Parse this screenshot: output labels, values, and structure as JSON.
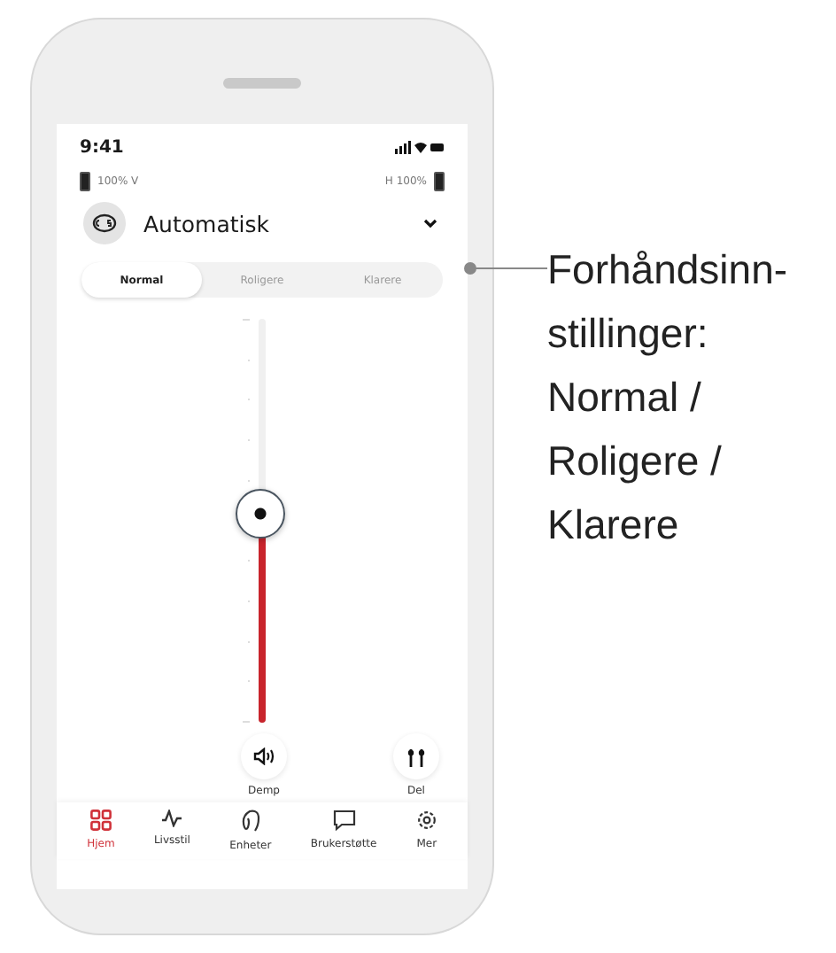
{
  "status_bar": {
    "time": "9:41"
  },
  "hearing_aids": {
    "left": "100% V",
    "right": "H 100%"
  },
  "program": {
    "label": "Automatisk"
  },
  "presets": [
    {
      "label": "Normal",
      "selected": true
    },
    {
      "label": "Roligere",
      "selected": false
    },
    {
      "label": "Klarere",
      "selected": false
    }
  ],
  "volume_slider": {
    "level": 0.52
  },
  "actions": [
    {
      "label": "Demp",
      "kind": "mute"
    },
    {
      "label": "Del",
      "kind": "split"
    }
  ],
  "nav": [
    {
      "label": "Hjem",
      "kind": "home",
      "selected": true
    },
    {
      "label": "Livsstil",
      "kind": "pulse",
      "selected": false
    },
    {
      "label": "Enheter",
      "kind": "device",
      "selected": false
    },
    {
      "label": "Brukerstøtte",
      "kind": "chat",
      "selected": false
    },
    {
      "label": "Mer",
      "kind": "gear",
      "selected": false
    }
  ],
  "annotation": {
    "text": "Forhåndsinn-\nstillinger:\nNormal /\nRoligere /\nKlarere"
  }
}
